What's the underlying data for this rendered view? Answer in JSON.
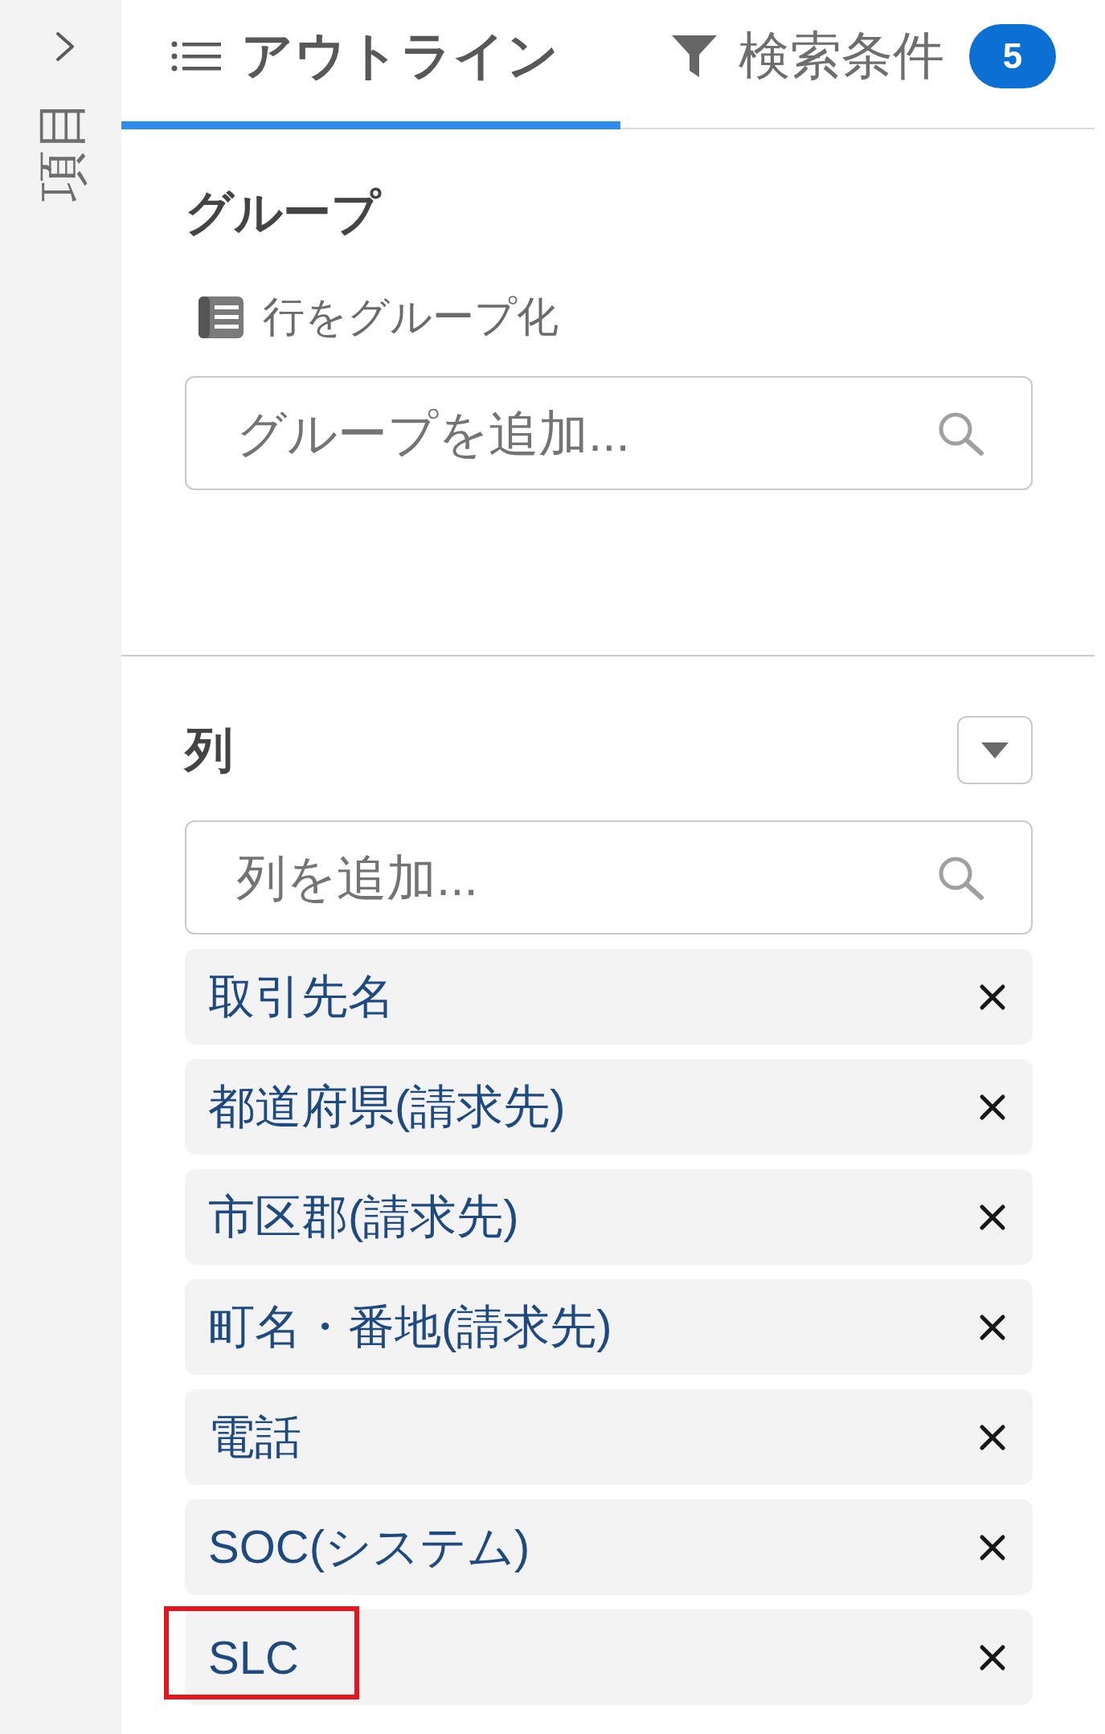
{
  "sidebar": {
    "label": "項目"
  },
  "tabs": [
    {
      "label": "アウトライン",
      "selected": true
    },
    {
      "label": "検索条件",
      "badge": "5",
      "selected": false
    }
  ],
  "group_section": {
    "title": "グループ",
    "subtitle": "行をグループ化",
    "search": {
      "placeholder": "グループを追加..."
    }
  },
  "columns_section": {
    "title": "列",
    "search": {
      "placeholder": "列を追加..."
    },
    "items": [
      {
        "label": "取引先名",
        "highlighted": false
      },
      {
        "label": "都道府県(請求先)",
        "highlighted": false
      },
      {
        "label": "市区郡(請求先)",
        "highlighted": false
      },
      {
        "label": "町名・番地(請求先)",
        "highlighted": false
      },
      {
        "label": "電話",
        "highlighted": false
      },
      {
        "label": "SOC(システム)",
        "highlighted": false
      },
      {
        "label": "SLC",
        "highlighted": true
      }
    ]
  }
}
